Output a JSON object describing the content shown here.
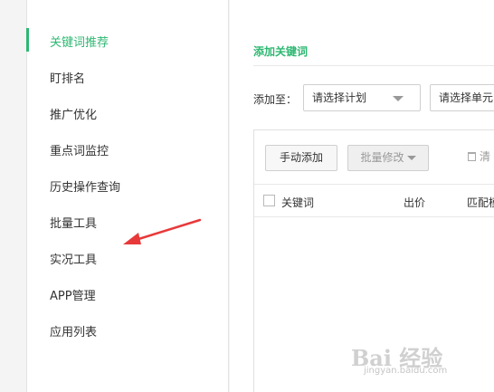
{
  "sidebar": {
    "items": [
      {
        "label": "关键词推荐",
        "active": true
      },
      {
        "label": "盯排名",
        "active": false
      },
      {
        "label": "推广优化",
        "active": false
      },
      {
        "label": "重点词监控",
        "active": false
      },
      {
        "label": "历史操作查询",
        "active": false
      },
      {
        "label": "批量工具",
        "active": false
      },
      {
        "label": "实况工具",
        "active": false
      },
      {
        "label": "APP管理",
        "active": false
      },
      {
        "label": "应用列表",
        "active": false
      }
    ]
  },
  "main": {
    "section_title": "添加关键词",
    "add_to_label": "添加至：",
    "plan_select": "请选择计划",
    "unit_select": "请选择单元",
    "manual_add_button": "手动添加",
    "batch_edit_button": "批量修改",
    "clear_label": "清",
    "table": {
      "headers": [
        "关键词",
        "出价",
        "匹配模"
      ]
    }
  },
  "annotation": {
    "arrow_color": "#e8393a"
  },
  "watermark": {
    "logo": "Bai 经验",
    "url": "jingyan.baidu.com"
  },
  "colors": {
    "accent": "#2eb872"
  }
}
